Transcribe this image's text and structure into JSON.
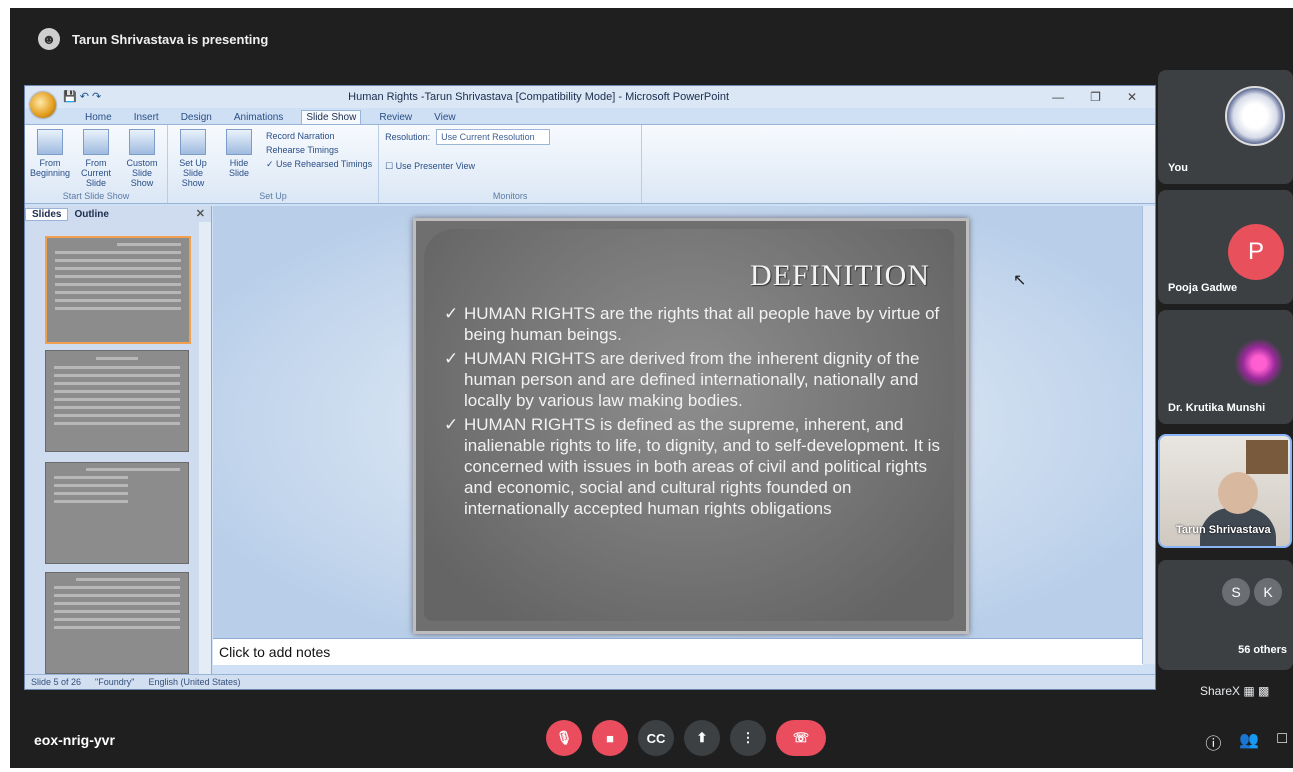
{
  "presenting": {
    "text": "Tarun Shrivastava is presenting"
  },
  "powerpoint": {
    "title": "Human Rights -Tarun Shrivastava [Compatibility Mode] - Microsoft PowerPoint",
    "tabs": [
      "Home",
      "Insert",
      "Design",
      "Animations",
      "Slide Show",
      "Review",
      "View"
    ],
    "ribbon": {
      "start": {
        "buttons": [
          "From Beginning",
          "From Current Slide",
          "Custom Slide Show"
        ],
        "group": "Start Slide Show"
      },
      "setup": {
        "buttons": [
          "Set Up Slide Show",
          "Hide Slide"
        ],
        "small": [
          "Record Narration",
          "Rehearse Timings",
          "Use Rehearsed Timings"
        ],
        "group": "Set Up"
      },
      "monitors": {
        "resolution_label": "Resolution:",
        "resolution_value": "Use Current Resolution",
        "presenter_view": "Use Presenter View",
        "group": "Monitors"
      }
    },
    "panel_tabs": [
      "Slides",
      "Outline"
    ],
    "slide": {
      "title": "DEFINITION",
      "bullets": [
        "HUMAN RIGHTS are the rights that all people have by virtue of being human beings.",
        "HUMAN RIGHTS are derived from the inherent dignity of the human person and are defined internationally, nationally and locally by various law making bodies.",
        "HUMAN RIGHTS is defined as the supreme, inherent, and inalienable rights to life, to dignity, and to self-development. It is concerned with issues in both areas of civil and political rights and economic, social and cultural rights founded on internationally accepted human rights obligations"
      ]
    },
    "notes_placeholder": "Click to add notes",
    "status": {
      "slide": "Slide 5 of 26",
      "theme": "\"Foundry\"",
      "language": "English (United States)"
    }
  },
  "participants": [
    {
      "name": "You"
    },
    {
      "name": "Pooja Gadwe",
      "initial": "P"
    },
    {
      "name": "Dr. Krutika Munshi"
    },
    {
      "name": "Tarun Shrivastava"
    },
    {
      "initials": [
        "S",
        "K"
      ],
      "label": "56 others"
    }
  ],
  "sharex": "ShareX",
  "meeting_code": "eox-nrig-yvr",
  "colors": {
    "danger": "#ea4d5e",
    "tile_bg": "#3c4043",
    "meet_bg": "#1f1f1f"
  }
}
